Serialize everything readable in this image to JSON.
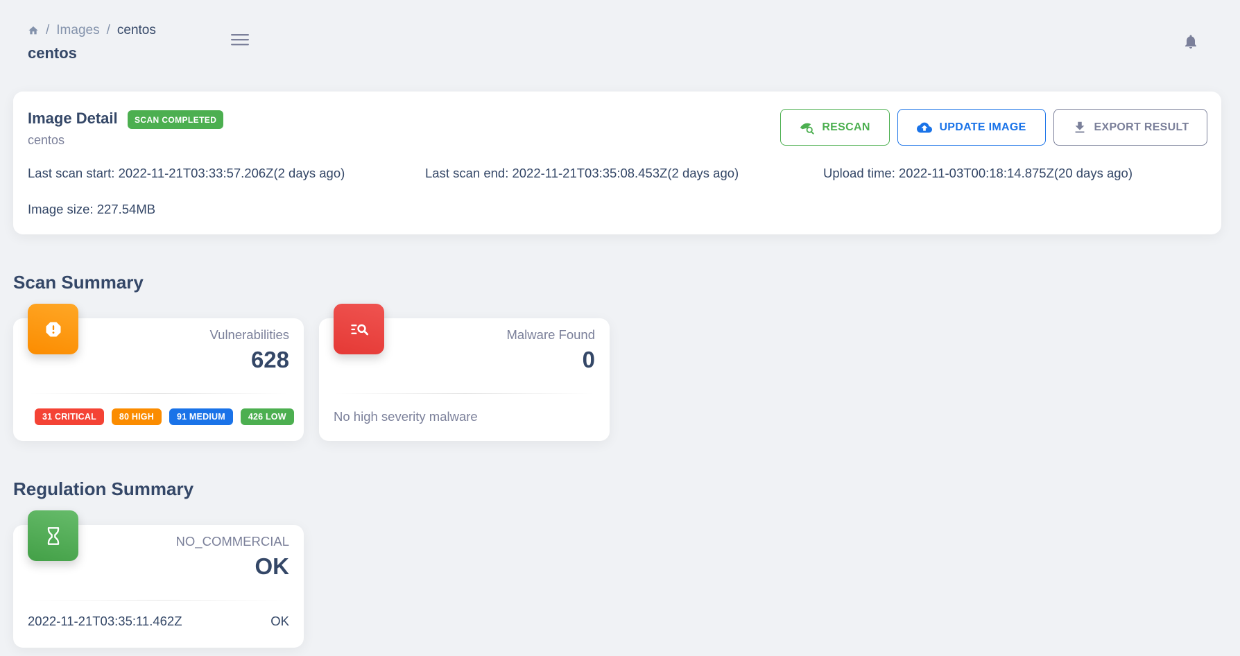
{
  "header": {
    "breadcrumb": {
      "home_icon": "home-icon",
      "items": [
        "Images",
        "centos"
      ],
      "separator": "/"
    },
    "title": "centos",
    "menu_icon": "menu-icon",
    "notification_icon": "bell-icon"
  },
  "detail": {
    "title": "Image Detail",
    "status": "SCAN COMPLETED",
    "image_name": "centos",
    "last_scan_start": "Last scan start: 2022-11-21T03:33:57.206Z(2 days ago)",
    "last_scan_end": "Last scan end: 2022-11-21T03:35:08.453Z(2 days ago)",
    "upload_time": "Upload time: 2022-11-03T00:18:14.875Z(20 days ago)",
    "image_size": "Image size: 227.54MB",
    "buttons": {
      "rescan": "RESCAN",
      "update": "UPDATE IMAGE",
      "export": "EXPORT RESULT"
    }
  },
  "scan_summary": {
    "title": "Scan Summary",
    "vulnerabilities": {
      "label": "Vulnerabilities",
      "value": "628",
      "icon": "alert-octagon-icon",
      "severities": {
        "critical": "31 CRITICAL",
        "high": "80 HIGH",
        "medium": "91 MEDIUM",
        "low": "426 LOW"
      }
    },
    "malware": {
      "label": "Malware Found",
      "value": "0",
      "icon": "search-list-icon",
      "footer": "No high severity malware"
    }
  },
  "regulation_summary": {
    "title": "Regulation Summary",
    "card": {
      "label": "NO_COMMERCIAL",
      "value": "OK",
      "icon": "hourglass-icon",
      "timestamp": "2022-11-21T03:35:11.462Z",
      "result": "OK"
    }
  },
  "colors": {
    "background": "#f0f2f5",
    "text": "#344767",
    "muted": "#7b809a",
    "success": "#4caf50",
    "info": "#1a73e8",
    "warning": "#fb8c00",
    "danger": "#f44335"
  }
}
